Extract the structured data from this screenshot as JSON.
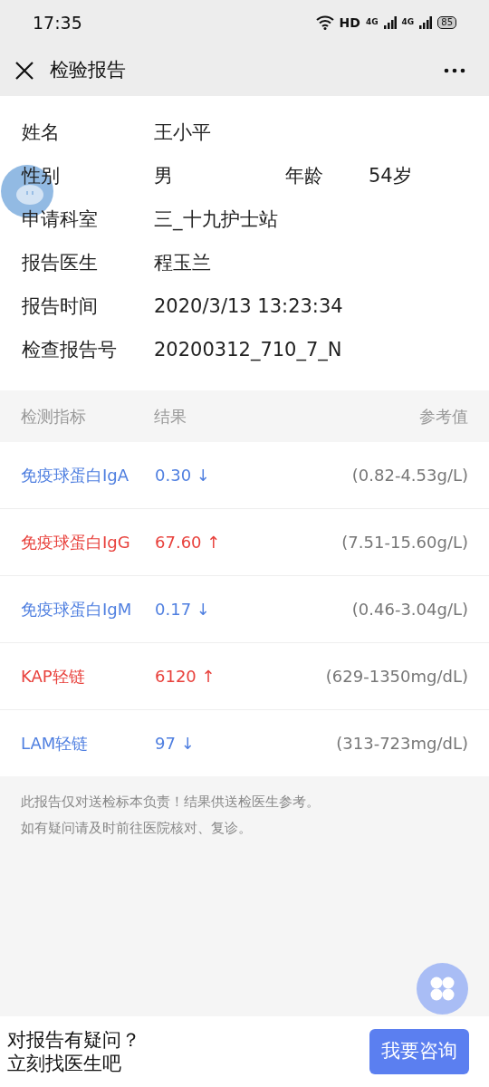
{
  "status_bar": {
    "time": "17:35",
    "network": "HD",
    "signal_1": "4G",
    "signal_2": "4G",
    "battery": "85"
  },
  "nav": {
    "title": "检验报告"
  },
  "patient": [
    {
      "label": "姓名",
      "value": "王小平"
    },
    {
      "label": "性别",
      "value": "男",
      "extra_label": "年龄",
      "extra_value": "54岁"
    },
    {
      "label": "申请科室",
      "value": "三_十九护士站"
    },
    {
      "label": "报告医生",
      "value": "程玉兰"
    },
    {
      "label": "报告时间",
      "value": "2020/3/13 13:23:34"
    },
    {
      "label": "检查报告号",
      "value": "20200312_710_7_N"
    }
  ],
  "table": {
    "columns": [
      "检测指标",
      "结果",
      "参考值"
    ],
    "rows": [
      {
        "name": "免疫球蛋白IgA",
        "result": "0.30 ↓",
        "range": "(0.82-4.53g/L)",
        "high": false
      },
      {
        "name": "免疫球蛋白IgG",
        "result": "67.60 ↑",
        "range": "(7.51-15.60g/L)",
        "high": true
      },
      {
        "name": "免疫球蛋白IgM",
        "result": "0.17 ↓",
        "range": "(0.46-3.04g/L)",
        "high": false
      },
      {
        "name": "KAP轻链",
        "result": "6120 ↑",
        "range": "(629-1350mg/dL)",
        "high": true
      },
      {
        "name": "LAM轻链",
        "result": "97 ↓",
        "range": "(313-723mg/dL)",
        "high": false
      }
    ]
  },
  "notes": [
    "此报告仅对送检标本负责！结果供送检医生参考。",
    "如有疑问请及时前往医院核对、复诊。"
  ],
  "bottom_bar": {
    "lines": [
      "对报告有疑问？",
      "立刻找医生吧"
    ],
    "button": "我要咨询"
  }
}
